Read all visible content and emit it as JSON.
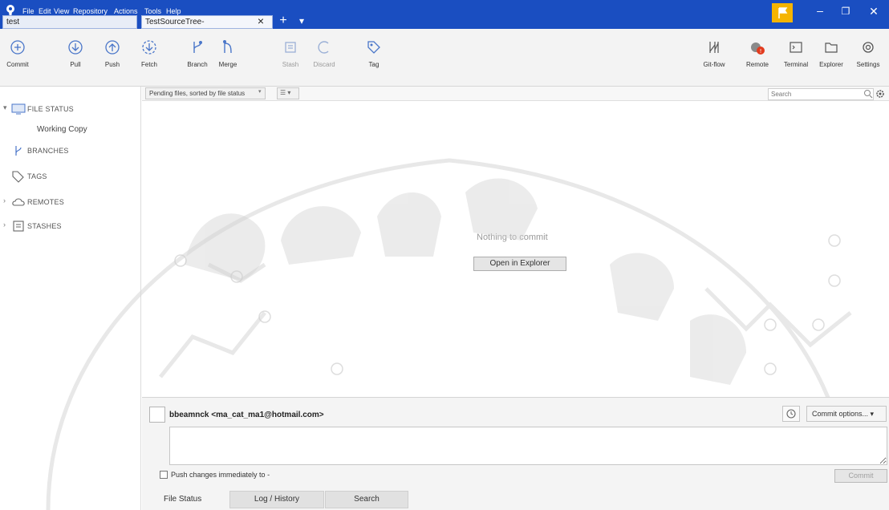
{
  "window": {
    "menu": [
      "File",
      "Edit",
      "View",
      "Repository",
      "Actions",
      "Tools",
      "Help"
    ],
    "repo_tab": "test",
    "doc_tab": "TestSourceTree-",
    "tab_close": "×",
    "tab_add": "+",
    "tab_more": "▾",
    "controls": {
      "minimize": "–",
      "maximize": "❐",
      "close": "✕"
    },
    "accent_color": "#1a4ec1",
    "flag_color": "#f5b400"
  },
  "toolbar": {
    "left": [
      {
        "label": "Commit",
        "icon": "commit-icon"
      },
      {
        "label": "Pull",
        "icon": "pull-icon"
      },
      {
        "label": "Push",
        "icon": "push-icon"
      },
      {
        "label": "Fetch",
        "icon": "fetch-icon"
      },
      {
        "label": "Branch",
        "icon": "branch-icon"
      },
      {
        "label": "Merge",
        "icon": "merge-icon"
      },
      {
        "label": "Stash",
        "icon": "stash-icon",
        "disabled": true
      },
      {
        "label": "Discard",
        "icon": "discard-icon",
        "disabled": true
      },
      {
        "label": "Tag",
        "icon": "tag-icon"
      }
    ],
    "right": [
      {
        "label": "Git-flow",
        "icon": "git-flow-icon"
      },
      {
        "label": "Remote",
        "icon": "remote-icon"
      },
      {
        "label": "Terminal",
        "icon": "terminal-icon"
      },
      {
        "label": "Explorer",
        "icon": "explorer-icon"
      },
      {
        "label": "Settings",
        "icon": "settings-icon"
      }
    ]
  },
  "sidebar": {
    "file_status": "FILE STATUS",
    "working_copy": "Working Copy",
    "branches": "BRANCHES",
    "tags": "TAGS",
    "remotes": "REMOTES",
    "stashes": "STASHES",
    "chevron_open": "▾",
    "chevron_closed": "›"
  },
  "filter": {
    "sort": "Pending files, sorted by file status",
    "sort_arrow": "▾",
    "view": "☰ ▾",
    "search_placeholder": "Search"
  },
  "main": {
    "empty_text": "Nothing to commit",
    "open_explorer": "Open in Explorer"
  },
  "commit": {
    "author": "bbeamnck <ma_cat_ma1@hotmail.com>",
    "options": "Commit options... ▾",
    "push_label": "Push changes immediately to -",
    "commit_button": "Commit"
  },
  "bottom_tabs": {
    "file_status": "File Status",
    "log_history": "Log / History",
    "search": "Search"
  }
}
